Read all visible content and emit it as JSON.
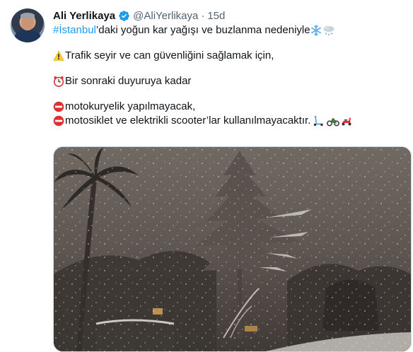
{
  "author": {
    "name": "Ali Yerlikaya",
    "handle": "@AliYerlikaya",
    "separator": "·",
    "time": "15d"
  },
  "tweet": {
    "hashtag": "#İstanbul",
    "line1_rest": "’daki yoğun kar yağışı ve buzlanma nedeniyle",
    "line2": "Trafik seyir ve can güvenliğini sağlamak için,",
    "line3": "Bir sonraki duyuruya kadar",
    "line4": "motokuryelik yapılmayacak,",
    "line5": "motosiklet ve elektrikli scooter’lar kullanılmayacaktır."
  },
  "icons": {
    "verified": "verified-badge-icon",
    "snowflake": "snowflake-icon",
    "snow_cloud": "snow-cloud-icon",
    "warning": "warning-icon",
    "alarm": "alarm-clock-icon",
    "no_entry": "no-entry-icon",
    "scooter": "kick-scooter-icon",
    "motorcycle": "motorcycle-icon",
    "motor_scooter": "motor-scooter-icon"
  },
  "colors": {
    "link": "#1d9bf0",
    "secondary_text": "#536471",
    "no_entry": "#e0302f"
  }
}
